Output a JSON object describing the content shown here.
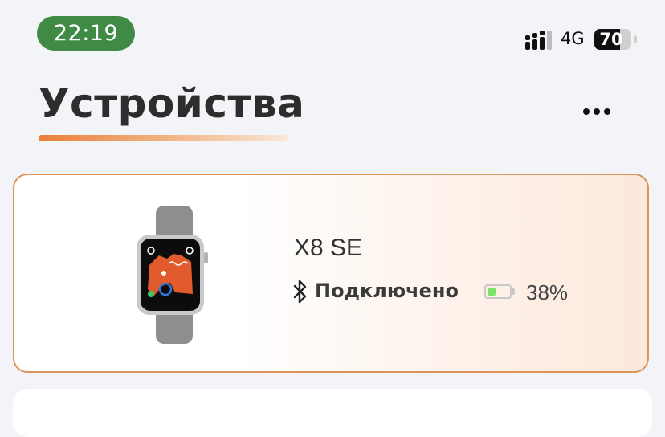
{
  "status_bar": {
    "time": "22:19",
    "network": "4G",
    "battery_percent": 70,
    "battery_text": "70",
    "signal_bars_active": 3,
    "signal_bars_total": 4
  },
  "header": {
    "title": "Устройства",
    "more_icon": "more-horizontal-icon"
  },
  "device_card": {
    "name": "X8 SE",
    "status": "Подключено",
    "bluetooth_icon": "bluetooth-icon",
    "battery_level": 0.38,
    "battery_label": "38%",
    "image": "smartwatch-image"
  },
  "colors": {
    "accent": "#ea7f3a",
    "status_time_bg": "#3f8a45",
    "card_border": "#dc9459",
    "battery_green": "#7be36a"
  }
}
